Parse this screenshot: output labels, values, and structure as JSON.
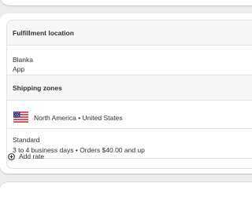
{
  "fulfillment": {
    "title": "Fulfillment location",
    "location_name": "Blanka",
    "location_type": "App"
  },
  "shipping": {
    "title": "Shipping zones",
    "zone": {
      "flag_icon": "us-flag-icon",
      "label": "North America • United States"
    },
    "rate": {
      "name": "Standard",
      "details": "3 to 4 business days • Orders $40.00 and up"
    },
    "add_rate_label": "Add rate",
    "add_rate_icon": "plus-circle-icon"
  }
}
